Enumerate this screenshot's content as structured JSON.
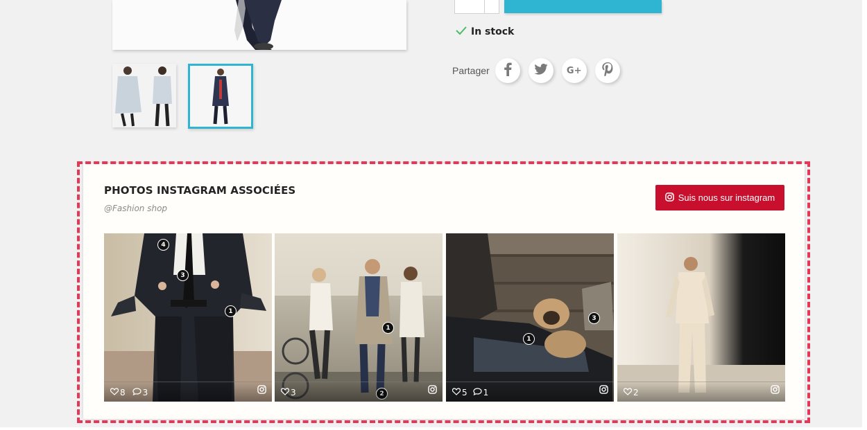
{
  "product": {
    "stock_text": "In stock",
    "share_label": "Partager",
    "social_icons": [
      "facebook-icon",
      "twitter-icon",
      "google-plus-icon",
      "pinterest-icon"
    ],
    "accent_color": "#2fb5d2"
  },
  "instagram": {
    "title": "PHOTOS INSTAGRAM ASSOCIÉES",
    "handle": "@Fashion shop",
    "follow_label": "Suis nous sur instagram",
    "button_color": "#c8102e",
    "photos": [
      {
        "likes": "8",
        "comments": "3",
        "tags": [
          "4",
          "3",
          "1"
        ]
      },
      {
        "likes": "3",
        "comments": "",
        "tags": [
          "1",
          "2"
        ]
      },
      {
        "likes": "5",
        "comments": "1",
        "tags": [
          "3",
          "1"
        ]
      },
      {
        "likes": "2",
        "comments": "",
        "tags": []
      }
    ]
  }
}
